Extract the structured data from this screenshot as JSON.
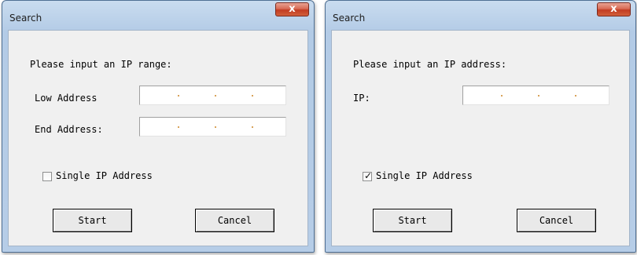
{
  "dialogs": [
    {
      "title": "Search",
      "close_symbol": "x",
      "prompt": "Please input an IP range:",
      "fields": [
        {
          "label": "Low Address",
          "value": ""
        },
        {
          "label": "End Address:",
          "value": ""
        }
      ],
      "checkbox": {
        "label": "Single IP Address",
        "checked": false
      },
      "buttons": {
        "start": "Start",
        "cancel": "Cancel"
      }
    },
    {
      "title": "Search",
      "close_symbol": "x",
      "prompt": "Please input an IP address:",
      "fields": [
        {
          "label": "IP:",
          "value": ""
        }
      ],
      "checkbox": {
        "label": "Single IP Address",
        "checked": true,
        "mark": "✓"
      },
      "buttons": {
        "start": "Start",
        "cancel": "Cancel"
      }
    }
  ],
  "colors": {
    "title_bar": "#b9cfe8",
    "client_bg": "#f0f0f0",
    "close_button": "#c9452c"
  }
}
